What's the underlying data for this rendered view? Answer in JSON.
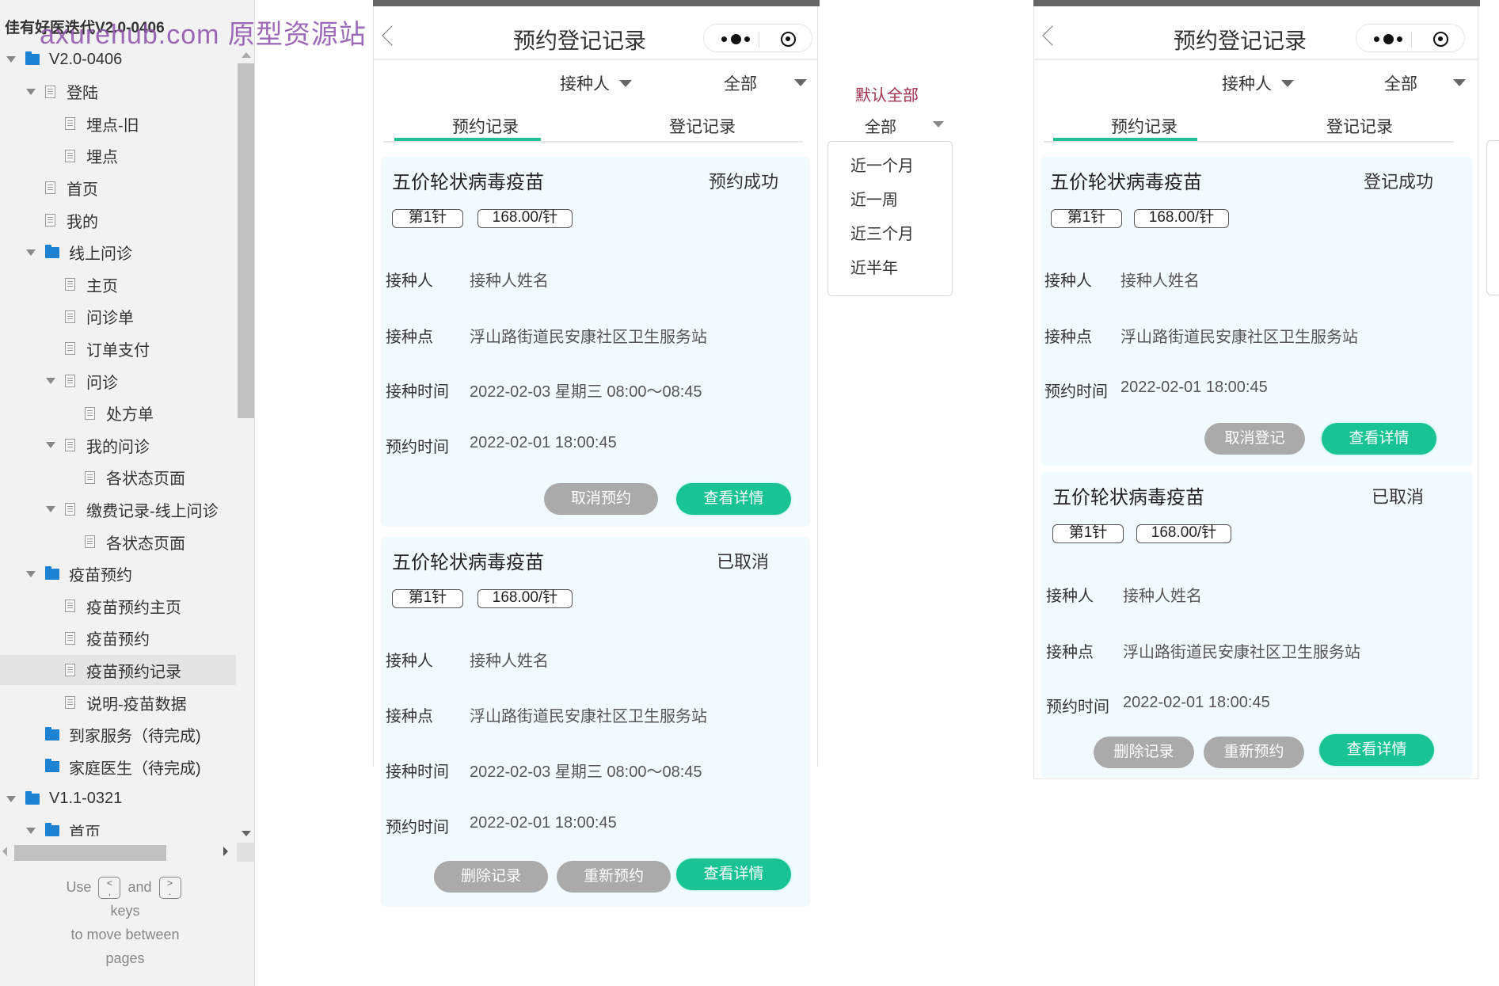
{
  "sidebar": {
    "project_title": "佳有好医迭代V2.0-0406",
    "tree": [
      {
        "label": "V2.0-0406",
        "type": "folder",
        "level": 0,
        "expanded": true
      },
      {
        "label": "登陆",
        "type": "page",
        "level": 1,
        "expanded": true
      },
      {
        "label": "埋点-旧",
        "type": "page",
        "level": 2
      },
      {
        "label": "埋点",
        "type": "page",
        "level": 2
      },
      {
        "label": "首页",
        "type": "page",
        "level": 1
      },
      {
        "label": "我的",
        "type": "page",
        "level": 1
      },
      {
        "label": "线上问诊",
        "type": "folder",
        "level": 1,
        "expanded": true
      },
      {
        "label": "主页",
        "type": "page",
        "level": 2
      },
      {
        "label": "问诊单",
        "type": "page",
        "level": 2
      },
      {
        "label": "订单支付",
        "type": "page",
        "level": 2
      },
      {
        "label": "问诊",
        "type": "page",
        "level": 2,
        "expanded": true
      },
      {
        "label": "处方单",
        "type": "page",
        "level": 3
      },
      {
        "label": "我的问诊",
        "type": "page",
        "level": 2,
        "expanded": true
      },
      {
        "label": "各状态页面",
        "type": "page",
        "level": 3
      },
      {
        "label": "缴费记录-线上问诊",
        "type": "page",
        "level": 2,
        "expanded": true
      },
      {
        "label": "各状态页面",
        "type": "page",
        "level": 3
      },
      {
        "label": "疫苗预约",
        "type": "folder",
        "level": 1,
        "expanded": true
      },
      {
        "label": "疫苗预约主页",
        "type": "page",
        "level": 2
      },
      {
        "label": "疫苗预约",
        "type": "page",
        "level": 2
      },
      {
        "label": "疫苗预约记录",
        "type": "page",
        "level": 2,
        "selected": true
      },
      {
        "label": "说明-疫苗数据",
        "type": "page",
        "level": 2
      },
      {
        "label": "到家服务（待完成)",
        "type": "folder",
        "level": 1
      },
      {
        "label": "家庭医生（待完成)",
        "type": "folder",
        "level": 1
      },
      {
        "label": "V1.1-0321",
        "type": "folder",
        "level": 0,
        "expanded": true
      },
      {
        "label": "首页",
        "type": "folder",
        "level": 1,
        "expanded": true
      }
    ],
    "key_help": {
      "use": "Use",
      "prev_key": "<\n,",
      "and": "and",
      "next_key": ">\n.",
      "keys": "keys",
      "line2": "to move between",
      "line3": "pages"
    }
  },
  "watermark": "axurehub.com 原型资源站",
  "phones": [
    {
      "nav_title": "预约登记记录",
      "filter_person": "接种人",
      "filter_range": "全部",
      "tabs": [
        {
          "label": "预约记录",
          "active": true
        },
        {
          "label": "登记记录",
          "active": false
        }
      ],
      "cards": [
        {
          "title": "五价轮状病毒疫苗",
          "status": "预约成功",
          "dose": "第1针",
          "price": "168.00/针",
          "fields": [
            {
              "label": "接种人",
              "value": "接种人姓名"
            },
            {
              "label": "接种点",
              "value": "浮山路街道民安康社区卫生服务站"
            },
            {
              "label": "接种时间",
              "value": "2022-02-03 星期三  08:00～08:45"
            },
            {
              "label": "预约时间",
              "value": "2022-02-01 18:00:45"
            }
          ],
          "buttons": [
            {
              "label": "取消预约",
              "style": "gray"
            },
            {
              "label": "查看详情",
              "style": "green"
            }
          ]
        },
        {
          "title": "五价轮状病毒疫苗",
          "status": "已取消",
          "dose": "第1针",
          "price": "168.00/针",
          "fields": [
            {
              "label": "接种人",
              "value": "接种人姓名"
            },
            {
              "label": "接种点",
              "value": "浮山路街道民安康社区卫生服务站"
            },
            {
              "label": "接种时间",
              "value": "2022-02-03 星期三  08:00～08:45"
            },
            {
              "label": "预约时间",
              "value": "2022-02-01 18:00:45"
            }
          ],
          "buttons": [
            {
              "label": "删除记录",
              "style": "gray"
            },
            {
              "label": "重新预约",
              "style": "gray"
            },
            {
              "label": "查看详情",
              "style": "green"
            }
          ]
        }
      ]
    },
    {
      "nav_title": "预约登记记录",
      "filter_person": "接种人",
      "filter_range": "全部",
      "tabs": [
        {
          "label": "预约记录",
          "active": true
        },
        {
          "label": "登记记录",
          "active": false
        }
      ],
      "cards": [
        {
          "title": "五价轮状病毒疫苗",
          "status": "登记成功",
          "dose": "第1针",
          "price": "168.00/针",
          "fields": [
            {
              "label": "接种人",
              "value": "接种人姓名"
            },
            {
              "label": "接种点",
              "value": "浮山路街道民安康社区卫生服务站"
            },
            {
              "label": "预约时间",
              "value": "2022-02-01 18:00:45"
            }
          ],
          "buttons": [
            {
              "label": "取消登记",
              "style": "gray"
            },
            {
              "label": "查看详情",
              "style": "green"
            }
          ]
        },
        {
          "title": "五价轮状病毒疫苗",
          "status": "已取消",
          "dose": "第1针",
          "price": "168.00/针",
          "fields": [
            {
              "label": "接种人",
              "value": "接种人姓名"
            },
            {
              "label": "接种点",
              "value": "浮山路街道民安康社区卫生服务站"
            },
            {
              "label": "预约时间",
              "value": "2022-02-01 18:00:45"
            }
          ],
          "buttons": [
            {
              "label": "删除记录",
              "style": "gray"
            },
            {
              "label": "重新预约",
              "style": "gray"
            },
            {
              "label": "查看详情",
              "style": "green"
            }
          ]
        }
      ]
    }
  ],
  "annotation": {
    "note": "默认全部",
    "selected": "全部",
    "options": [
      "近一个月",
      "近一周",
      "近三个月",
      "近半年"
    ]
  },
  "colors": {
    "accent": "#19c394",
    "button_gray": "#aaaaaa",
    "card_bg": "#f1faff",
    "folder": "#1e82d2",
    "annotation_note": "#a0304a"
  }
}
